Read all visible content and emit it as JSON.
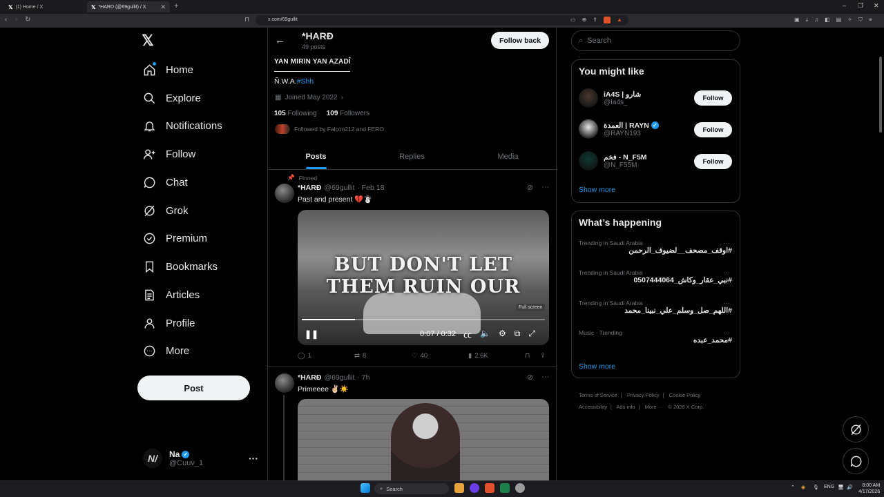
{
  "browser": {
    "tabs": [
      {
        "title": "(1) Home / X",
        "active": false
      },
      {
        "title": "*HARD (@69gullit) / X",
        "active": true
      }
    ],
    "new_tab": "+",
    "url": "x.com/69gullit",
    "window_controls": [
      "–",
      "❐",
      "✕"
    ]
  },
  "nav": {
    "logo": "𝕏",
    "items": [
      {
        "label": "Home",
        "icon": "home-icon"
      },
      {
        "label": "Explore",
        "icon": "search-icon"
      },
      {
        "label": "Notifications",
        "icon": "bell-icon"
      },
      {
        "label": "Follow",
        "icon": "person-plus-icon"
      },
      {
        "label": "Chat",
        "icon": "chat-icon"
      },
      {
        "label": "Grok",
        "icon": "grok-icon"
      },
      {
        "label": "Premium",
        "icon": "verified-badge-icon"
      },
      {
        "label": "Bookmarks",
        "icon": "bookmark-icon"
      },
      {
        "label": "Articles",
        "icon": "articles-icon"
      },
      {
        "label": "Profile",
        "icon": "person-icon"
      },
      {
        "label": "More",
        "icon": "more-circle-icon"
      }
    ],
    "post_label": "Post",
    "account": {
      "name": "Na",
      "handle": "@Cuuv_1",
      "avatar_text": "N/"
    }
  },
  "profile": {
    "name": "*HARĐ",
    "posts_count": "49 posts",
    "follow_back_label": "Follow back",
    "bio_line1": "YAN MIRIN YAN AZADÎ",
    "bio_line2_prefix": "Ñ.W.A.",
    "bio_line2_tag": "#Shh",
    "joined": "Joined May 2022",
    "following_count": "105",
    "following_label": "Following",
    "followers_count": "109",
    "followers_label": "Followers",
    "followed_by": "Followed by Falcon212 and FERO",
    "tabs": [
      "Posts",
      "Replies",
      "Media"
    ]
  },
  "tweets": [
    {
      "pinned_label": "Pinned",
      "name": "*HARĐ",
      "handle": "@69gullit",
      "time": "· Feb 18",
      "text": "Past and present 💔☃️",
      "video": {
        "caption_line1": "BUT DON'T LET",
        "caption_line2": "THEM RUIN OUR",
        "tooltip": "Full screen",
        "time": "0:07 / 0:32",
        "progress": 0.22
      },
      "replies": "1",
      "reposts": "8",
      "likes": "40",
      "views": "2.6K"
    },
    {
      "name": "*HARĐ",
      "handle": "@69gullit",
      "time": "· 7h",
      "text": "Primeeee ✌🏻☀️"
    }
  ],
  "search": {
    "placeholder": "Search"
  },
  "who_to_follow": {
    "title": "You might like",
    "users": [
      {
        "name": "iA4S | شارو",
        "handle": "@Ia4s_",
        "verified": false,
        "color": "#4a3a30"
      },
      {
        "name": "العمدة | RAYN",
        "handle": "@RAYN193",
        "verified": true,
        "color": "#e8e8e8"
      },
      {
        "name": "فخم - N_F5M",
        "handle": "@N_F55M",
        "verified": false,
        "color": "#0e3b33"
      }
    ],
    "follow_label": "Follow",
    "show_more": "Show more"
  },
  "trends": {
    "title": "What’s happening",
    "items": [
      {
        "category": "Trending in Saudi Arabia",
        "name": "#اوقف_مصحف__لضيوف_الرحمن"
      },
      {
        "category": "Trending in Saudi Arabia",
        "name": "#نبي_عقار_وكاش_0507444064"
      },
      {
        "category": "Trending in Saudi Arabia",
        "name": "#اللهم_صل_وسلم_علي_نبينا_محمد"
      },
      {
        "category": "Music · Trending",
        "name": "#محمد_عبده"
      }
    ],
    "show_more": "Show more"
  },
  "footer": [
    "Terms of Service",
    "|",
    "Privacy Policy",
    "|",
    "Cookie Policy",
    "|",
    "Accessibility",
    "|",
    "Ads info",
    "|",
    "More ···",
    "© 2026 X Corp."
  ],
  "taskbar": {
    "search_label": "Search",
    "lang": "ENG",
    "time": "8:00 AM",
    "date": "4/17/2026"
  },
  "colors": {
    "accent": "#1d9bf0",
    "background": "#000000",
    "border": "#2f3336",
    "muted": "#71767b"
  }
}
